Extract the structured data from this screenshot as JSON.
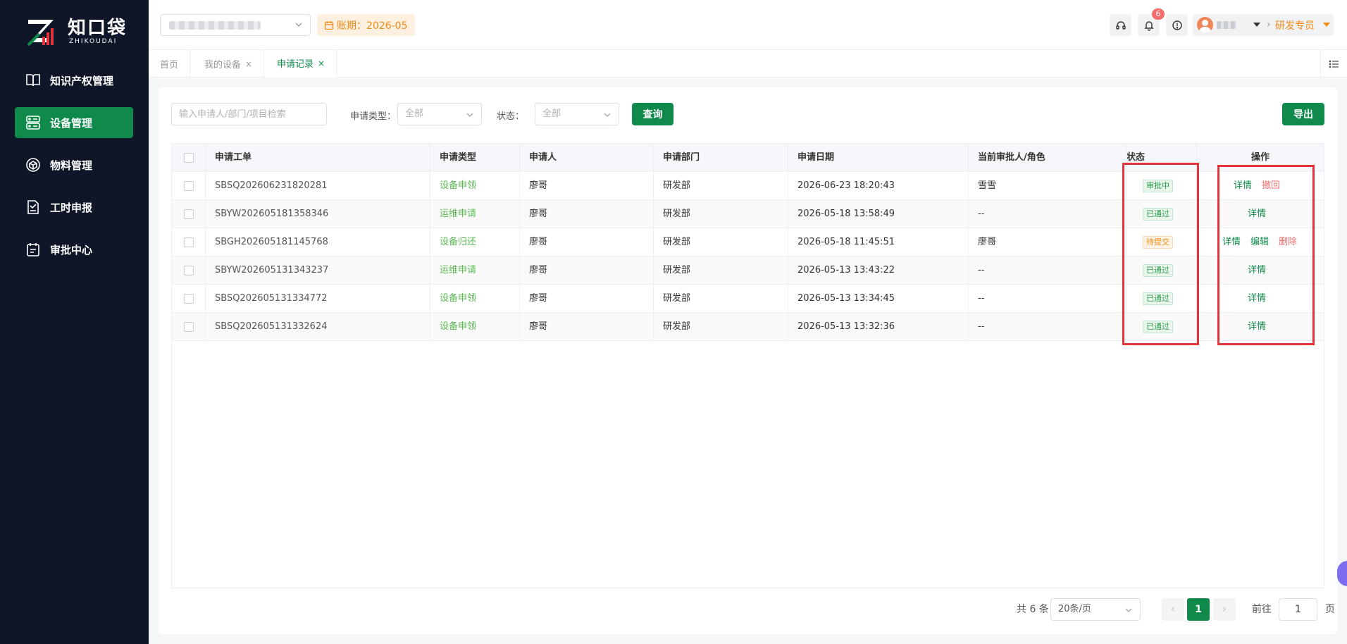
{
  "sidebar": {
    "logo_cn": "知口袋",
    "logo_en": "ZHIKOUDAI",
    "items": [
      {
        "label": "知识产权管理",
        "icon": "book-icon",
        "active": false
      },
      {
        "label": "设备管理",
        "icon": "device-icon",
        "active": true
      },
      {
        "label": "物料管理",
        "icon": "material-icon",
        "active": false
      },
      {
        "label": "工时申报",
        "icon": "timesheet-icon",
        "active": false
      },
      {
        "label": "审批中心",
        "icon": "approval-icon",
        "active": false
      }
    ]
  },
  "topbar": {
    "period_label": "账期：2026-05",
    "notification_count": "6",
    "role": "研发专员"
  },
  "tabs": [
    {
      "label": "首页",
      "closable": false,
      "active": false
    },
    {
      "label": "我的设备",
      "closable": true,
      "active": false
    },
    {
      "label": "申请记录",
      "closable": true,
      "active": true
    }
  ],
  "filters": {
    "search_placeholder": "输入申请人/部门/项目检索",
    "type_label": "申请类型：",
    "type_value": "全部",
    "status_label": "状态：",
    "status_value": "全部",
    "query_button": "查询",
    "export_button": "导出"
  },
  "table": {
    "columns": [
      "申请工单",
      "申请类型",
      "申请人",
      "申请部门",
      "申请日期",
      "当前审批人/角色",
      "状态",
      "操作"
    ],
    "rows": [
      {
        "order": "SBSQ202606231820281",
        "type": "设备申领",
        "applicant": "廖哥",
        "dept": "研发部",
        "date": "2026-06-23 18:20:43",
        "approver": "雪雪",
        "status": "审批中",
        "status_color": "green",
        "actions": [
          {
            "label": "详情",
            "color": "green"
          },
          {
            "label": "撤回",
            "color": "red"
          }
        ]
      },
      {
        "order": "SBYW202605181358346",
        "type": "运维申请",
        "applicant": "廖哥",
        "dept": "研发部",
        "date": "2026-05-18 13:58:49",
        "approver": "--",
        "status": "已通过",
        "status_color": "green",
        "actions": [
          {
            "label": "详情",
            "color": "green"
          }
        ]
      },
      {
        "order": "SBGH202605181145768",
        "type": "设备归还",
        "applicant": "廖哥",
        "dept": "研发部",
        "date": "2026-05-18 11:45:51",
        "approver": "廖哥",
        "status": "待提交",
        "status_color": "orange",
        "actions": [
          {
            "label": "详情",
            "color": "green"
          },
          {
            "label": "编辑",
            "color": "green"
          },
          {
            "label": "删除",
            "color": "red"
          }
        ]
      },
      {
        "order": "SBYW202605131343237",
        "type": "运维申请",
        "applicant": "廖哥",
        "dept": "研发部",
        "date": "2026-05-13 13:43:22",
        "approver": "--",
        "status": "已通过",
        "status_color": "green",
        "actions": [
          {
            "label": "详情",
            "color": "green"
          }
        ]
      },
      {
        "order": "SBSQ202605131334772",
        "type": "设备申领",
        "applicant": "廖哥",
        "dept": "研发部",
        "date": "2026-05-13 13:34:45",
        "approver": "--",
        "status": "已通过",
        "status_color": "green",
        "actions": [
          {
            "label": "详情",
            "color": "green"
          }
        ]
      },
      {
        "order": "SBSQ202605131332624",
        "type": "设备申领",
        "applicant": "廖哥",
        "dept": "研发部",
        "date": "2026-05-13 13:32:36",
        "approver": "--",
        "status": "已通过",
        "status_color": "green",
        "actions": [
          {
            "label": "详情",
            "color": "green"
          }
        ]
      }
    ]
  },
  "pagination": {
    "total": "共 6 条",
    "page_size": "20条/页",
    "current_page": "1",
    "goto_label": "前往",
    "goto_value": "1",
    "page_suffix": "页"
  },
  "colors": {
    "primary": "#0f8a4b",
    "sidebar_bg": "#0e1628",
    "danger": "#f56c6c",
    "warning": "#f08a16",
    "highlight_box": "#e5333b"
  }
}
